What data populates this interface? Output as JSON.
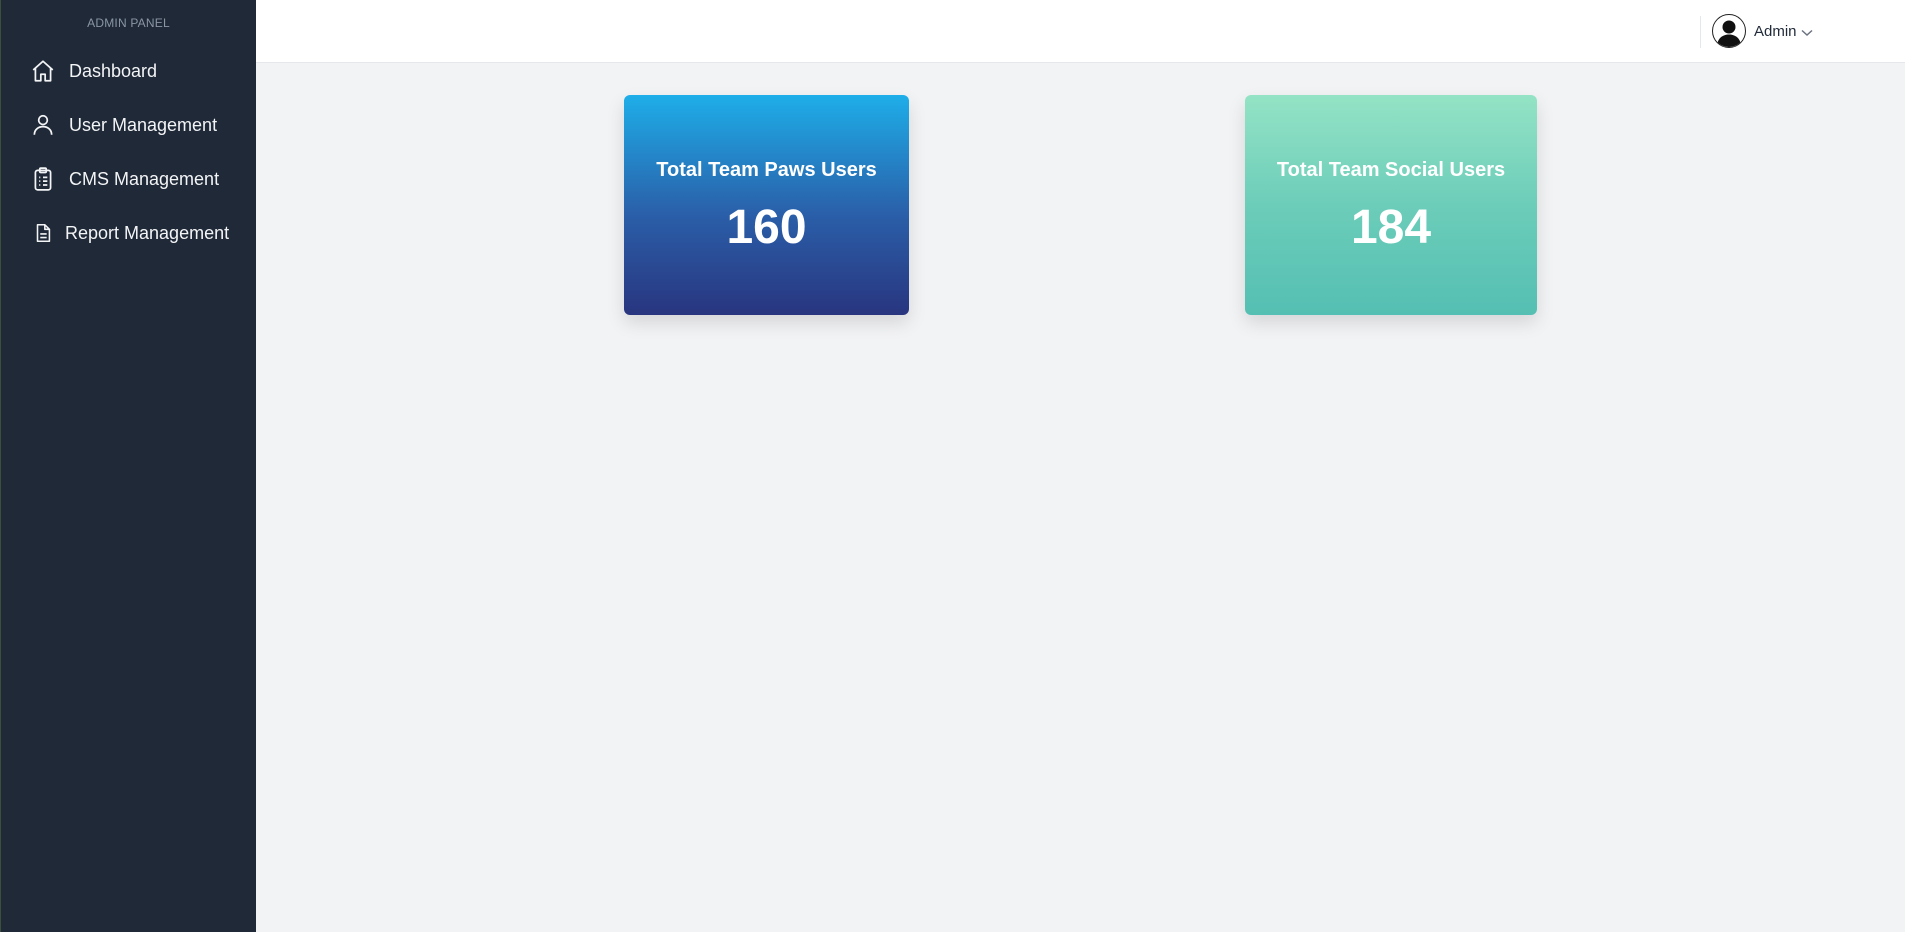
{
  "sidebar": {
    "brand": "ADMIN PANEL",
    "items": [
      {
        "label": "Dashboard",
        "icon": "home-icon"
      },
      {
        "label": "User Management",
        "icon": "user-icon"
      },
      {
        "label": "CMS Management",
        "icon": "clipboard-icon"
      },
      {
        "label": "Report Management",
        "icon": "document-icon"
      }
    ]
  },
  "header": {
    "user_name": "Admin"
  },
  "stats": [
    {
      "title": "Total Team Paws Users",
      "value": "160",
      "accent": "#1eaee9"
    },
    {
      "title": "Total Team Social Users",
      "value": "184",
      "accent": "#6ccdb9"
    }
  ],
  "colors": {
    "sidebar_bg": "#1f2937",
    "page_bg": "#f2f3f5"
  }
}
